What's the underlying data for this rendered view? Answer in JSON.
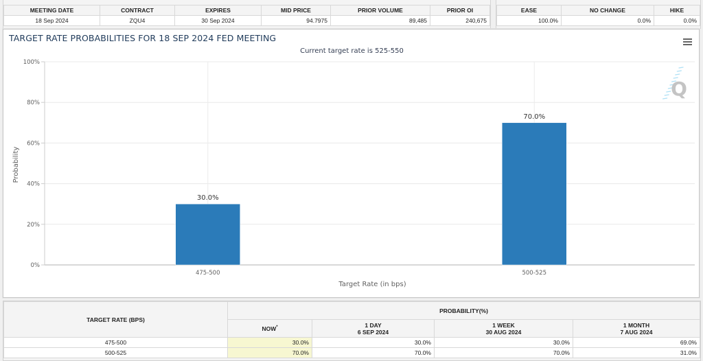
{
  "contract_table": {
    "headers": [
      "MEETING DATE",
      "CONTRACT",
      "EXPIRES",
      "MID PRICE",
      "PRIOR VOLUME",
      "PRIOR OI"
    ],
    "row": [
      "18 Sep 2024",
      "ZQU4",
      "30 Sep 2024",
      "94.7975",
      "89,485",
      "240,675"
    ]
  },
  "outcome_table": {
    "headers": [
      "EASE",
      "NO CHANGE",
      "HIKE"
    ],
    "row": [
      "100.0%",
      "0.0%",
      "0.0%"
    ]
  },
  "chart_panel": {
    "title": "TARGET RATE PROBABILITIES FOR 18 SEP 2024 FED MEETING",
    "subtitle": "Current target rate is 525-550",
    "menu_icon": "hamburger-menu-icon",
    "watermark_icon": "q-logo-icon"
  },
  "chart_data": {
    "type": "bar",
    "title": "TARGET RATE PROBABILITIES FOR 18 SEP 2024 FED MEETING",
    "subtitle": "Current target rate is 525-550",
    "categories": [
      "475-500",
      "500-525"
    ],
    "values": [
      30.0,
      70.0
    ],
    "data_labels": [
      "30.0%",
      "70.0%"
    ],
    "xlabel": "Target Rate (in bps)",
    "ylabel": "Probability",
    "ylim": [
      0,
      100
    ],
    "yticks": [
      0,
      20,
      40,
      60,
      80,
      100
    ],
    "ytick_labels": [
      "0%",
      "20%",
      "40%",
      "60%",
      "80%",
      "100%"
    ],
    "grid": true,
    "bar_color": "#2b7bb9"
  },
  "probability_table": {
    "rate_header": "TARGET RATE (BPS)",
    "group_header": "PROBABILITY(%)",
    "columns": [
      {
        "label": "NOW",
        "sub": "",
        "marker": "*"
      },
      {
        "label": "1 DAY",
        "sub": "6 SEP 2024"
      },
      {
        "label": "1 WEEK",
        "sub": "30 AUG 2024"
      },
      {
        "label": "1 MONTH",
        "sub": "7 AUG 2024"
      }
    ],
    "rows": [
      {
        "rate": "475-500",
        "values": [
          "30.0%",
          "30.0%",
          "30.0%",
          "69.0%"
        ]
      },
      {
        "rate": "500-525",
        "values": [
          "70.0%",
          "70.0%",
          "70.0%",
          "31.0%"
        ]
      }
    ]
  }
}
